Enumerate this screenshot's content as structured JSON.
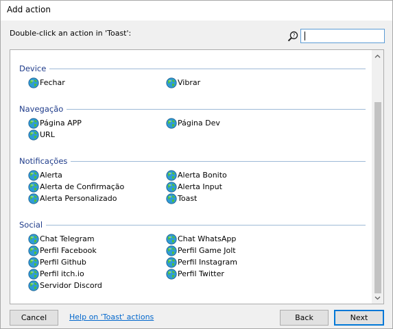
{
  "window": {
    "title": "Add action"
  },
  "prompt": "Double-click an action in 'Toast':",
  "search": {
    "value": "",
    "placeholder": ""
  },
  "groups": [
    {
      "title": "Device",
      "items": [
        {
          "label": "Fechar",
          "col": 0
        },
        {
          "label": "Vibrar",
          "col": 1
        }
      ]
    },
    {
      "title": "Navegação",
      "items": [
        {
          "label": "Página APP",
          "col": 0
        },
        {
          "label": "Página Dev",
          "col": 1
        },
        {
          "label": "URL",
          "col": 0
        }
      ]
    },
    {
      "title": "Notificações",
      "items": [
        {
          "label": "Alerta",
          "col": 0
        },
        {
          "label": "Alerta Bonito",
          "col": 1
        },
        {
          "label": "Alerta de Confirmação",
          "col": 0
        },
        {
          "label": "Alerta Input",
          "col": 1
        },
        {
          "label": "Alerta Personalizado",
          "col": 0
        },
        {
          "label": "Toast",
          "col": 1
        }
      ]
    },
    {
      "title": "Social",
      "items": [
        {
          "label": "Chat Telegram",
          "col": 0
        },
        {
          "label": "Chat WhatsApp",
          "col": 1
        },
        {
          "label": "Perfil Facebook",
          "col": 0
        },
        {
          "label": "Perfil Game Jolt",
          "col": 1
        },
        {
          "label": "Perfil Github",
          "col": 0
        },
        {
          "label": "Perfil Instagram",
          "col": 1
        },
        {
          "label": "Perfil itch.io",
          "col": 0
        },
        {
          "label": "Perfil Twitter",
          "col": 1
        },
        {
          "label": "Servidor Discord",
          "col": 0
        }
      ]
    }
  ],
  "footer": {
    "cancel_label": "Cancel",
    "help_label": "Help on 'Toast' actions",
    "back_label": "Back",
    "next_label": "Next"
  },
  "colors": {
    "group_title": "#1e3b8a",
    "group_rule": "#9db9d6",
    "link": "#0066cc",
    "focus_border": "#0078d7"
  },
  "icons": {
    "action_item": "globe-icon",
    "search": "search-icon",
    "scroll_up": "chevron-up-icon",
    "scroll_down": "chevron-down-icon"
  }
}
